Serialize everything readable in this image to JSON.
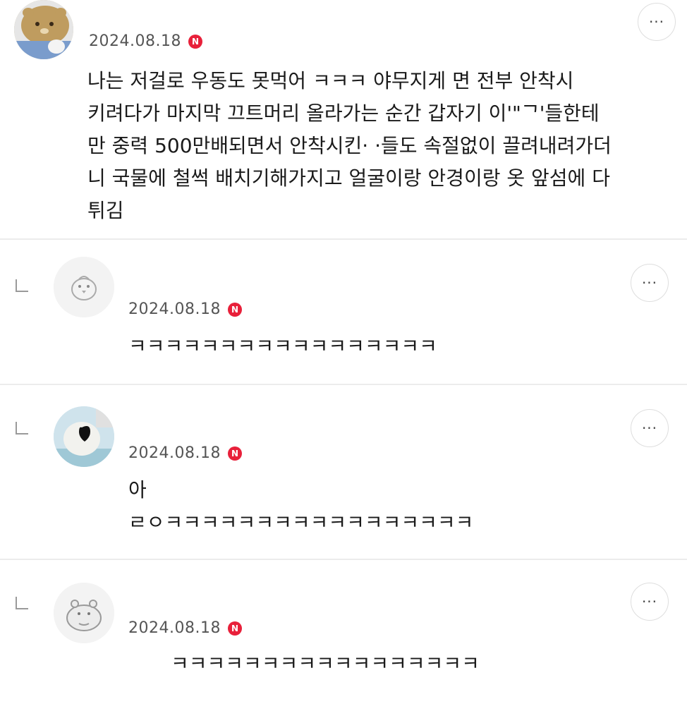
{
  "comments": [
    {
      "date": "2024.08.18",
      "badge": "N",
      "more": "···",
      "lines": [
        "나는 저걸로 우동도 못먹어      ㅋㅋㅋ 야무지게 면 전부 안착시",
        "키려다가 마지막 끄트머리 올라가는 순간 갑자기 이'\"ᄀ'들한테",
        "만 중력 500만배되면서 안착시킨· ·들도 속절없이 끌려내려가더",
        "니 국물에 철썩 배치기해가지고 얼굴이랑 안경이랑 옷 앞섬에 다",
        "튀김"
      ]
    },
    {
      "date": "2024.08.18",
      "badge": "N",
      "more": "···",
      "lines": [
        "ㅋㅋㅋㅋㅋㅋㅋㅋㅋㅋㅋㅋㅋㅋㅋㅋㅋ"
      ]
    },
    {
      "date": "2024.08.18",
      "badge": "N",
      "more": "···",
      "lines": [
        "아",
        "ㄹㅇㅋㅋㅋㅋㅋㅋㅋㅋㅋㅋㅋㅋㅋㅋㅋㅋㅋ"
      ]
    },
    {
      "date": "2024.08.18",
      "badge": "N",
      "more": "···",
      "lines": [
        "ㅋㅋㅋㅋㅋㅋㅋㅋㅋㅋㅋㅋㅋㅋㅋㅋㅋ"
      ]
    }
  ],
  "colors": {
    "badge": "#e8203a",
    "date": "#555555",
    "divider": "#ececec"
  }
}
